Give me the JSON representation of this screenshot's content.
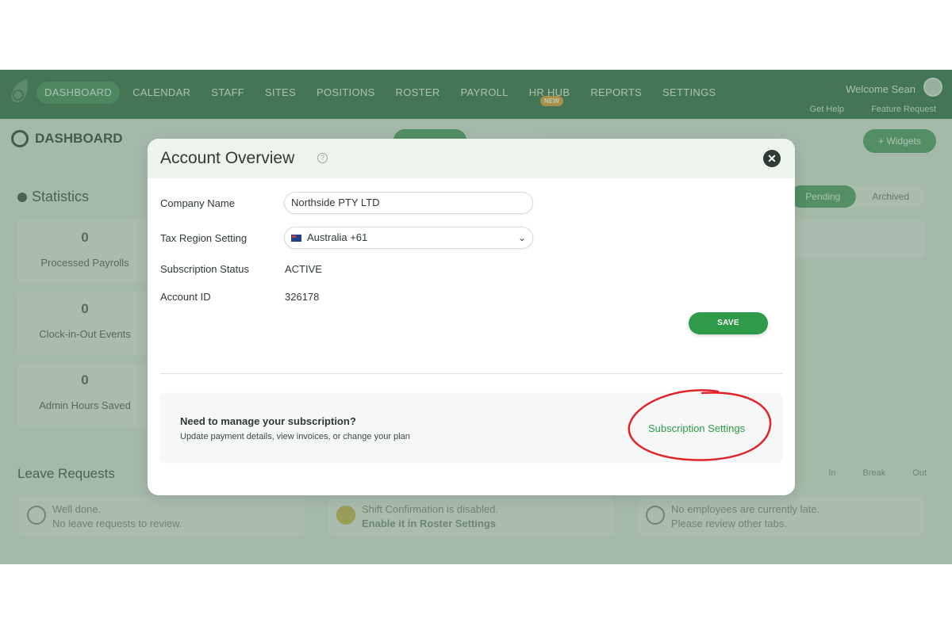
{
  "nav": {
    "items": [
      "DASHBOARD",
      "CALENDAR",
      "STAFF",
      "SITES",
      "POSITIONS",
      "ROSTER",
      "PAYROLL",
      "HR HUB",
      "REPORTS",
      "SETTINGS"
    ],
    "hr_badge": "NEW",
    "welcome": "Welcome Sean",
    "get_help": "Get Help",
    "feature_request": "Feature Request"
  },
  "dashboard": {
    "title": "DASHBOARD",
    "widgets_button": "+ Widgets",
    "statistics_title": "Statistics",
    "stats": [
      {
        "value": "0",
        "label": "Processed Payrolls"
      },
      {
        "value": "0",
        "label": "Clock-in-Out Events"
      },
      {
        "value": "0",
        "label": "Admin Hours Saved"
      }
    ],
    "leave_tabs": [
      "Pending",
      "Archived"
    ],
    "leave_title": "Leave Requests",
    "attendance_tabs": [
      "In",
      "Break",
      "Out"
    ],
    "cards": [
      {
        "line1": "Well done.",
        "line2": "No leave requests to review."
      },
      {
        "line1": "Shift Confirmation is disabled.",
        "line2": "Enable it in Roster Settings"
      },
      {
        "line1": "No employees are currently late.",
        "line2": "Please review other tabs."
      }
    ]
  },
  "modal": {
    "title": "Account Overview",
    "close_symbol": "✕",
    "company_name_label": "Company Name",
    "company_name_value": "Northside PTY LTD",
    "tax_region_label": "Tax Region Setting",
    "tax_region_value": "Australia +61",
    "subscription_status_label": "Subscription Status",
    "subscription_status_value": "ACTIVE",
    "account_id_label": "Account ID",
    "account_id_value": "326178",
    "save_label": "SAVE",
    "manage_heading": "Need to manage your subscription?",
    "manage_text": "Update payment details, view invoices, or change your plan",
    "subscription_link": "Subscription Settings"
  },
  "colors": {
    "brand_green": "#2f9a4a",
    "nav_bg": "#2e6b45",
    "highlight_circle": "#e0242b"
  }
}
